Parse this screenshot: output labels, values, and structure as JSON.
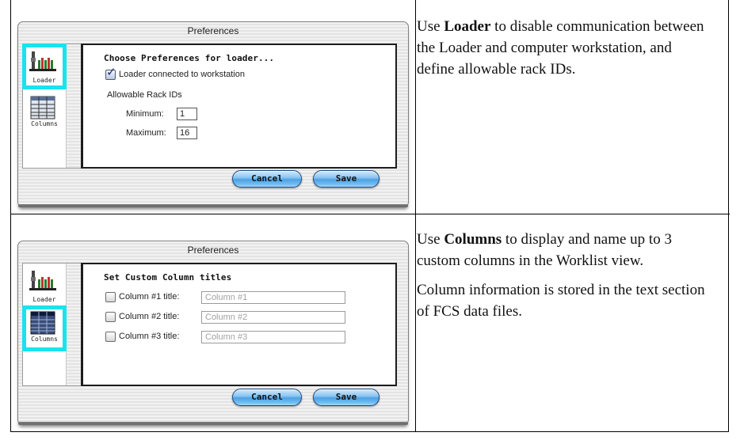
{
  "rows": [
    {
      "dialog": {
        "title": "Preferences",
        "sidebar": [
          {
            "label": "Loader",
            "icon": "loader-icon",
            "selected": true
          },
          {
            "label": "Columns",
            "icon": "columns-icon",
            "selected": false
          }
        ],
        "pane_title": "Choose Preferences for loader...",
        "checkbox_label": "Loader connected to workstation",
        "checkbox_checked": true,
        "group_label": "Allowable Rack IDs",
        "minimum_label": "Minimum:",
        "minimum_value": "1",
        "maximum_label": "Maximum:",
        "maximum_value": "16",
        "cancel_label": "Cancel",
        "save_label": "Save"
      },
      "description": {
        "p1_pre": "Use ",
        "p1_bold": "Loader",
        "p1_post": " to disable communication between the Loader and computer workstation, and define allowable rack IDs."
      }
    },
    {
      "dialog": {
        "title": "Preferences",
        "sidebar": [
          {
            "label": "Loader",
            "icon": "loader-icon",
            "selected": false
          },
          {
            "label": "Columns",
            "icon": "columns-icon",
            "selected": true
          }
        ],
        "pane_title": "Set Custom Column titles",
        "columns": [
          {
            "label": "Column #1 title:",
            "placeholder": "Column #1",
            "checked": false
          },
          {
            "label": "Column #2 title:",
            "placeholder": "Column #2",
            "checked": false
          },
          {
            "label": "Column #3 title:",
            "placeholder": "Column #3",
            "checked": false
          }
        ],
        "cancel_label": "Cancel",
        "save_label": "Save"
      },
      "description": {
        "p1_pre": "Use ",
        "p1_bold": "Columns",
        "p1_post": " to display and name up to 3 custom columns in the Worklist view.",
        "p2": "Column information is stored in the text section of FCS data files."
      }
    }
  ],
  "colors": {
    "highlight": "#19e3ee",
    "aqua_button": "#4da2e3",
    "border": "#000000"
  }
}
